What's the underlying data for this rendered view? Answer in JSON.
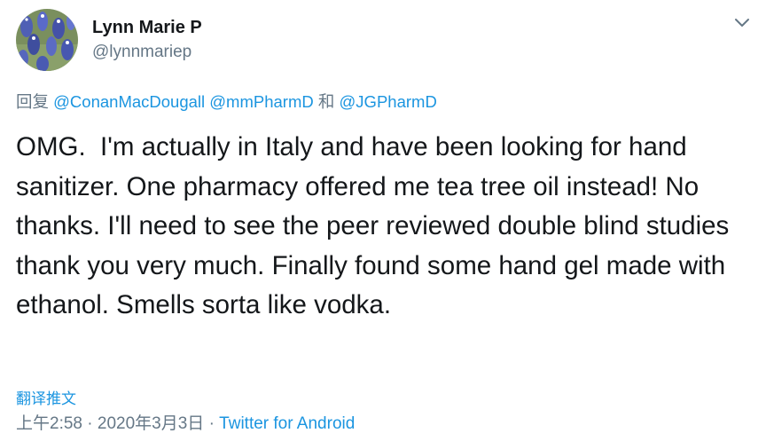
{
  "author": {
    "display_name": "Lynn Marie P",
    "handle": "@lynnmariep",
    "avatar_icon": "bluebonnet-flowers-avatar"
  },
  "menu_icon": "chevron-down-icon",
  "reply": {
    "prefix": "回复",
    "mention_1": "@ConanMacDougall",
    "mention_2": "@mmPharmD",
    "conjunction": "和",
    "mention_3": "@JGPharmD"
  },
  "tweet_text": "OMG.  I'm actually in Italy and have been looking for hand sanitizer. One pharmacy offered me tea tree oil instead! No thanks. I'll need to see the peer reviewed double blind studies thank you very much. Finally found some hand gel made with ethanol. Smells sorta like vodka.",
  "translate_label": "翻译推文",
  "meta": {
    "time": "上午2:58",
    "separator": "·",
    "date": "2020年3月3日",
    "source": "Twitter for Android"
  },
  "colors": {
    "link": "#1b95e0",
    "secondary_text": "#657786",
    "primary_text": "#14171a"
  }
}
